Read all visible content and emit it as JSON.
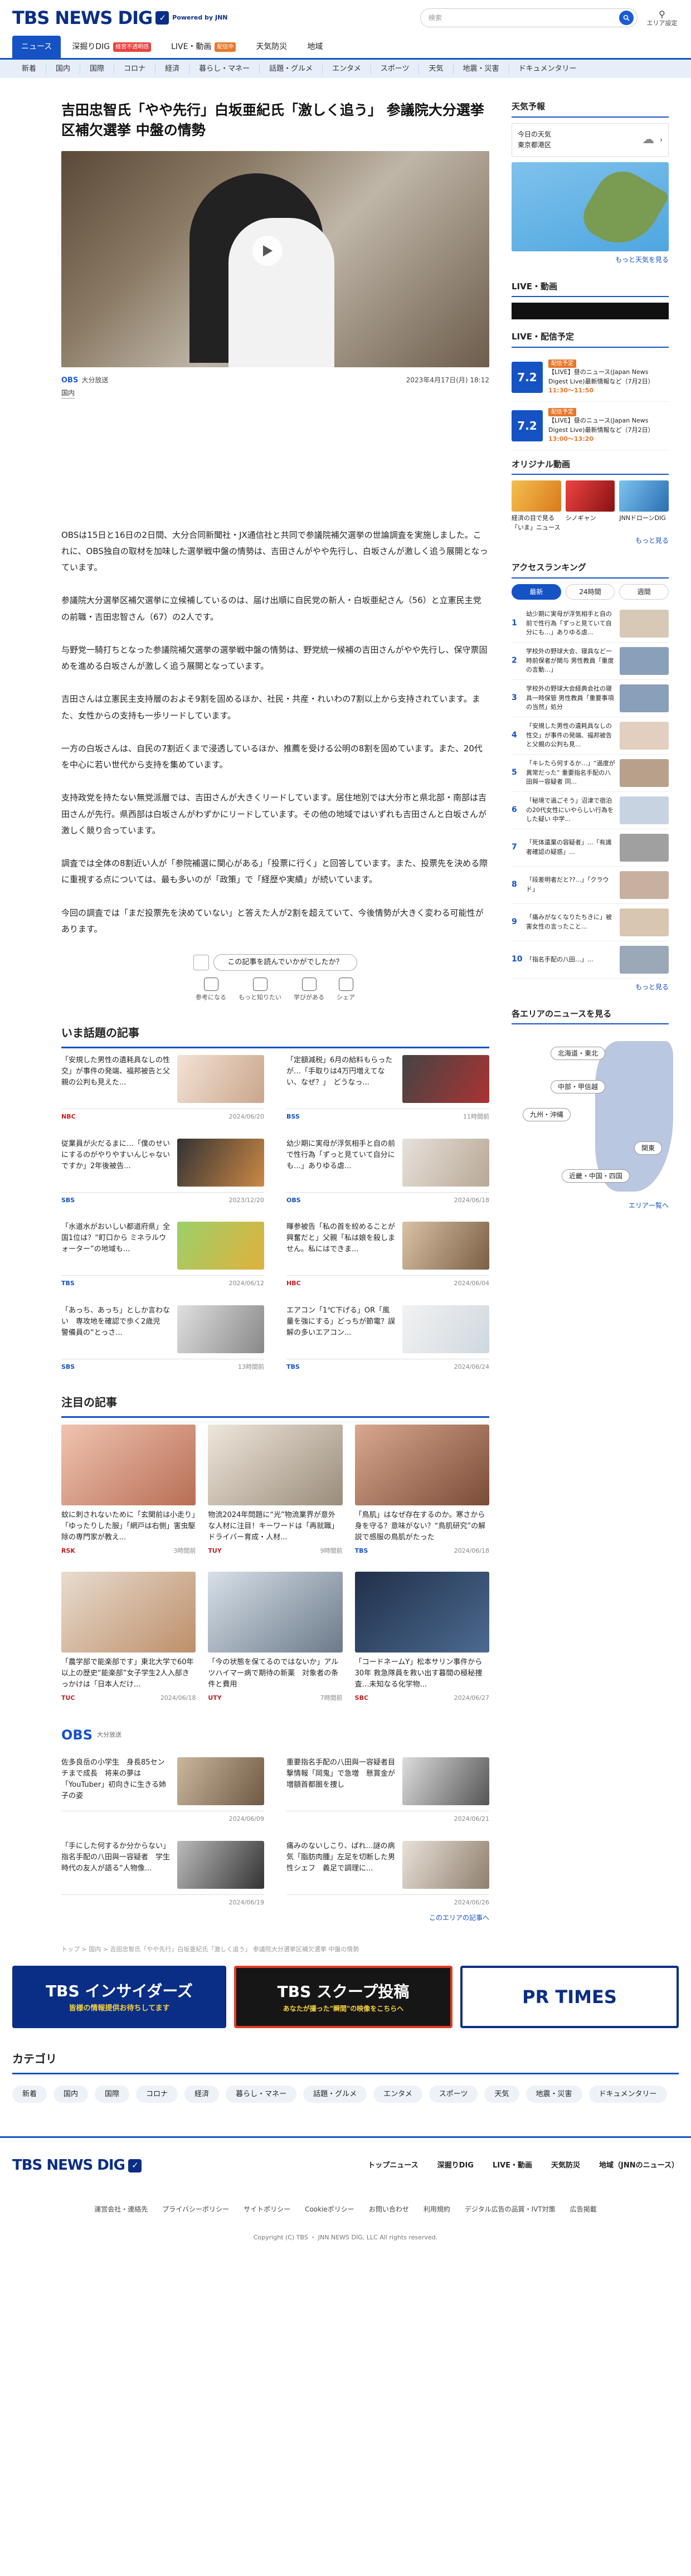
{
  "header": {
    "logo": "TBS NEWS DIG",
    "powered": "Powered by JNN",
    "search_placeholder": "検索",
    "area_label": "エリア設定"
  },
  "nav_main": [
    {
      "label": "ニュース",
      "active": true
    },
    {
      "label": "深掘りDIG",
      "badge": "経営不透明感"
    },
    {
      "label": "LIVE・動画",
      "badge": "配信中"
    },
    {
      "label": "天気防災"
    },
    {
      "label": "地域"
    }
  ],
  "nav_sub": [
    "新着",
    "国内",
    "国際",
    "コロナ",
    "経済",
    "暮らし・マネー",
    "話題・グルメ",
    "エンタメ",
    "スポーツ",
    "天気",
    "地震・災害",
    "ドキュメンタリー"
  ],
  "article": {
    "title": "吉田忠智氏「やや先行」白坂亜紀氏「激しく追う」 参議院大分選挙区補欠選挙 中盤の情勢",
    "source": "大分放送",
    "source_logo": "OBS",
    "date": "2023年4月17日(月) 18:12",
    "category": "国内",
    "paragraphs": [
      "OBSは15日と16日の2日間、大分合同新聞社・JX通信社と共同で参議院補欠選挙の世論調査を実施しました。これに、OBS独自の取材を加味した選挙戦中盤の情勢は、吉田さんがやや先行し、白坂さんが激しく追う展開となっています。",
      "参議院大分選挙区補欠選挙に立候補しているのは、届け出順に自民党の新人・白坂亜紀さん（56）と立憲民主党の前職・吉田忠智さん（67）の2人です。",
      "与野党一騎打ちとなった参議院補欠選挙の選挙戦中盤の情勢は、野党統一候補の吉田さんがやや先行し、保守票固めを進める白坂さんが激しく追う展開となっています。",
      "吉田さんは立憲民主支持層のおよそ9割を固めるほか、社民・共産・れいわの7割以上から支持されています。また、女性からの支持も一歩リードしています。",
      "一方の白坂さんは、自民の7割近くまで浸透しているほか、推薦を受ける公明の8割を固めています。また、20代を中心に若い世代から支持を集めています。",
      "支持政党を持たない無党派層では、吉田さんが大きくリードしています。居住地別では大分市と県北部・南部は吉田さんが先行。県西部は白坂さんがわずかにリードしています。その他の地域ではいずれも吉田さんと白坂さんが激しく競り合っています。",
      "調査では全体の8割近い人が「参院補選に関心がある」「投票に行く」と回答しています。また、投票先を決める際に重視する点については、最も多いのが「政策」で「経歴や実績」が続いています。",
      "今回の調査では「まだ投票先を決めていない」と答えた人が2割を超えていて、今後情勢が大きく変わる可能性があります。"
    ]
  },
  "feedback": {
    "question": "この記事を読んでいかがでしたか？",
    "buttons": [
      "参考になる",
      "もっと知りたい",
      "学びがある",
      "シェア"
    ]
  },
  "trending": {
    "title": "いま話題の記事",
    "items": [
      {
        "text": "「安規した男性の遺耗具なしの性交」が事件の発端、福邦被告と父親の公判も見えた...",
        "source": "NBC",
        "date": "2024/06/20"
      },
      {
        "text": "「定額減税」6月の給料もらったが…「手取りは4万円増えてない、なぜ？」　どうなっ...",
        "source": "BSS",
        "date": "11時間前"
      },
      {
        "text": "従業員が火だるまに…「僕のせいにするのがやりやすいんじゃないですか」2年後被告...",
        "source": "SBS",
        "date": "2023/12/20"
      },
      {
        "text": "幼少期に実母が浮気相手と自の前で性行為「ずっと見ていて自分にも…」ありゆる虐...",
        "source": "OBS",
        "date": "2024/06/18"
      },
      {
        "text": "「水道水がおいしい都道府県」全国1位は？“町口から ミネラルウォーター”の地域も...",
        "source": "TBS",
        "date": "2024/06/12"
      },
      {
        "text": "暉参被告「私の首を絞めることが興奮だと」父親「私は娘を殺しません。私にはできま...",
        "source": "HBC",
        "date": "2024/06/04"
      },
      {
        "text": "「あっち、あっち」としか言わない　専攻地を確認で歩く2歳児　警備員の“とっさ...",
        "source": "SBS",
        "date": "13時間前"
      },
      {
        "text": "エアコン「1℃下げる」OR「風量を強にする」どっちが節電？誤解の多いエアコン...",
        "source": "TBS",
        "date": "2024/06/24"
      }
    ]
  },
  "featured": {
    "title": "注目の記事",
    "items": [
      {
        "text": "蚊に刺されないために「玄関前は小走り」「ゆったりした服」「網戸は右側」害虫駆除の専門家が教え...",
        "source": "RSK",
        "date": "3時間前"
      },
      {
        "text": "物流2024年問題に“光”物流業界が意外な人材に注目！キーワードは「再就職」ドライバー育成・人材...",
        "source": "TUY",
        "date": "9時間前"
      },
      {
        "text": "「鳥肌」はなぜ存在するのか。寒さから身を守る？意味がない？“鳥肌研究”の解説で感服の鳥肌がたった",
        "source": "TBS",
        "date": "2024/06/18"
      },
      {
        "text": "「農学部で能楽部です」東北大学で60年以上の歴史“能楽部”女子学生2人入部きっかけは「日本人だけ...",
        "source": "TUC",
        "date": "2024/06/18"
      },
      {
        "text": "「今の状態を保てるのではないか」アルツハイマー病で期待の新薬　対象者の条件と費用",
        "source": "UTY",
        "date": "7時間前"
      },
      {
        "text": "「コードネームY」松本サリン事件から30年 救急隊員を救い出す暮間の極秘捜査…未知なる化学物...",
        "source": "SBC",
        "date": "2024/06/27"
      }
    ]
  },
  "obs_block": {
    "title": "OBS",
    "subtitle": "大分放送",
    "items": [
      {
        "text": "佐多良岳の小学生　身長85センチまで成長　将来の夢は「YouTuber」初向きに生きる姉子の姿",
        "date": "2024/06/09"
      },
      {
        "text": "重要指名手配の八田與一容疑者目撃情報「岡鬼」で急増　懸賞金が増額首都圏を捜し",
        "date": "2024/06/21"
      },
      {
        "text": "「手にした何するか分からない」指名手配の八田與一容疑者　学生時代の友人が語る“人物像...",
        "date": "2024/06/19"
      },
      {
        "text": "痛みのないしこり、ばれ…謎の病気「脂肪肉腫」左足を切断した男性シェフ　義足で調理に...",
        "date": "2024/06/26"
      }
    ],
    "more": "このエリアの記事へ"
  },
  "breadcrumb": "トップ > 国内 > 吉田忠智氏「やや先行」白坂亜紀氏「激しく追う」 参議院大分選挙区補欠選挙 中盤の情勢",
  "banners": [
    "TBS インサイダーズ",
    "TBS スクープ投稿",
    "PR TIMES"
  ],
  "banner_sub": {
    "insiders": "皆様の情報提供お待ちしてます",
    "scoop": "あなたが撮った\"瞬間\"の映像をこちらへ"
  },
  "categories": {
    "title": "カテゴリ",
    "items": [
      "新着",
      "国内",
      "国際",
      "コロナ",
      "経済",
      "暮らし・マネー",
      "話題・グルメ",
      "エンタメ",
      "スポーツ",
      "天気",
      "地震・災害",
      "ドキュメンタリー"
    ]
  },
  "footer": {
    "links": [
      "トップニュース",
      "深掘りDIG",
      "LIVE・動画",
      "天気防災",
      "地域（JNNのニュース）"
    ],
    "sub_links": [
      "運営会社・連絡先",
      "プライバシーポリシー",
      "サイトポリシー",
      "Cookieポリシー",
      "お問い合わせ",
      "利用規約",
      "デジタル広告の品質・IVT対策",
      "広告掲載"
    ],
    "copyright": "Copyright (C) TBS ・ JNN NEWS DIG, LLC All rights reserved."
  },
  "sidebar": {
    "weather": {
      "title": "天気予報",
      "label1": "今日の天気",
      "label2": "東京都港区",
      "more": "もっと天気を見る"
    },
    "live": {
      "title": "LIVE・動画",
      "schedule_title": "LIVE・配信予定",
      "items": [
        {
          "date": "7.2",
          "text": "【LIVE】昼のニュース(Japan News Digest Live)最新情報など（7月2日）",
          "time": "11:30～11:50",
          "tag": "配信予定"
        },
        {
          "date": "7.2",
          "text": "【LIVE】昼のニュース(Japan News Digest Live)最新情報など（7月2日）",
          "time": "13:00～13:20",
          "tag": "配信予定"
        }
      ],
      "original_title": "オリジナル動画",
      "originals": [
        "経済の目で見る「いま」ニュース",
        "シノギャン",
        "JNNドローンDIG"
      ],
      "more": "もっと見る"
    },
    "ranking": {
      "title": "アクセスランキング",
      "tabs": [
        "最新",
        "24時間",
        "週間"
      ],
      "items": [
        "幼少期に実母が浮気相手と自の前で性行為「ずっと見ていて自分にも…」ありゆる虐...",
        "学校外の野球大会、寝具など一時前保者が関与 男性教員「重度の言動…」",
        "学校外の野球大会経典会社の寝具一時保管 男性教員「重要事項の当然」処分",
        "「安規した男性の遺耗具なしの性交」が事件の発端、福邦被告と父親の公判も見...",
        "「キレたら何するか…」“過度が異常だった” 重要指名手配の八田與一容疑者 同...",
        "「秘境で過ごそう」沼津で宿泊の20代女性にいやらしい行為をした疑い 中学...",
        "「死体遺棄の容疑者」...「有識者確認の疑惑」...",
        "「段差明者だと??...」「クラウド」",
        "「痛みがなくなりたちきに」被害女性の言ったこと...",
        "「指名手配の八田…」..."
      ],
      "more": "もっと見る"
    },
    "areas": {
      "title": "各エリアのニュースを見る",
      "items": [
        "北海道・東北",
        "中部・甲信越",
        "九州・沖縄",
        "関東",
        "近畿・中国・四国"
      ],
      "more": "エリア一覧へ"
    }
  },
  "colors": {
    "brand": "#0a2e86",
    "accent": "#1552c4"
  }
}
